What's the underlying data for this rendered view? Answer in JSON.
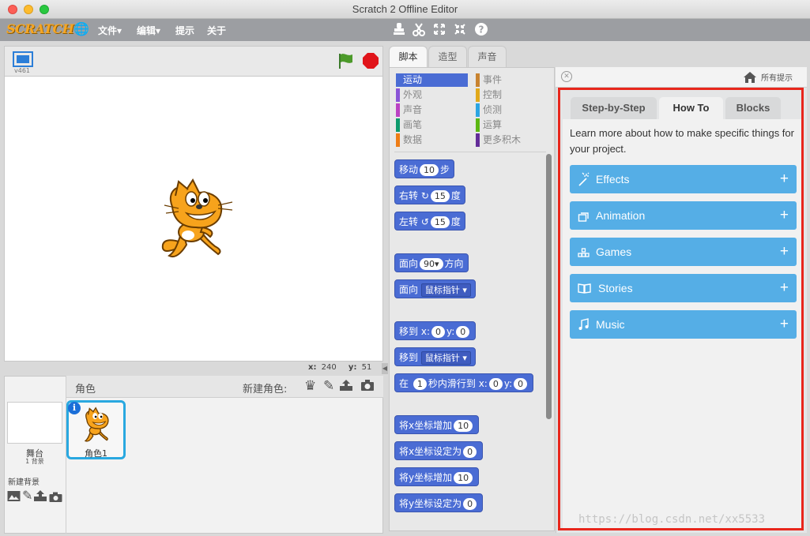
{
  "window": {
    "title": "Scratch 2 Offline Editor"
  },
  "menubar": {
    "logo": "SCRATCH",
    "menus": [
      "文件▾",
      "编辑▾",
      "提示",
      "关于"
    ]
  },
  "stage": {
    "version": "v461",
    "coords": {
      "x_label": "x:",
      "x_value": "240",
      "y_label": "y:",
      "y_value": "51"
    }
  },
  "sprite_panel": {
    "title": "角色",
    "new_sprite_label": "新建角色:",
    "stage_label": "舞台",
    "stage_sub": "1 背景",
    "new_backdrop_label": "新建背景",
    "sprite_name": "角色1"
  },
  "tabs": [
    "脚本",
    "造型",
    "声音"
  ],
  "categories_left": [
    {
      "label": "运动",
      "color": "#4a6cd4"
    },
    {
      "label": "外观",
      "color": "#8a55d7"
    },
    {
      "label": "声音",
      "color": "#bb42c3"
    },
    {
      "label": "画笔",
      "color": "#0e9a6c"
    },
    {
      "label": "数据",
      "color": "#ee7d16"
    }
  ],
  "categories_right": [
    {
      "label": "事件",
      "color": "#c88330"
    },
    {
      "label": "控制",
      "color": "#e1a91a"
    },
    {
      "label": "侦测",
      "color": "#2ca5e2"
    },
    {
      "label": "运算",
      "color": "#5cb712"
    },
    {
      "label": "更多积木",
      "color": "#632d99"
    }
  ],
  "blocks": {
    "move": {
      "pre": "移动",
      "val": "10",
      "post": "步"
    },
    "turn_right": {
      "pre": "右转",
      "val": "15",
      "post": "度"
    },
    "turn_left": {
      "pre": "左转",
      "val": "15",
      "post": "度"
    },
    "point_dir": {
      "pre": "面向",
      "val": "90▾",
      "post": "方向"
    },
    "point_towards": {
      "pre": "面向",
      "dd": "鼠标指针"
    },
    "goto_xy": {
      "pre": "移到",
      "x": "x:",
      "xv": "0",
      "y": "y:",
      "yv": "0"
    },
    "goto": {
      "pre": "移到",
      "dd": "鼠标指针"
    },
    "glide": {
      "pre": "在",
      "secs": "1",
      "mid": "秒内滑行到",
      "x": "x:",
      "xv": "0",
      "y": "y:",
      "yv": "0"
    },
    "change_x": {
      "label": "将x坐标增加",
      "val": "10"
    },
    "set_x": {
      "label": "将x坐标设定为",
      "val": "0"
    },
    "change_y": {
      "label": "将y坐标增加",
      "val": "10"
    },
    "set_y": {
      "label": "将y坐标设定为",
      "val": "0"
    }
  },
  "tips": {
    "home_label": "所有提示",
    "tabs": [
      "Step-by-Step",
      "How To",
      "Blocks"
    ],
    "active_tab": "How To",
    "intro": "Learn more about how to make specific things for your project.",
    "sections": [
      {
        "label": "Effects",
        "icon": "effects-icon"
      },
      {
        "label": "Animation",
        "icon": "animation-icon"
      },
      {
        "label": "Games",
        "icon": "games-icon"
      },
      {
        "label": "Stories",
        "icon": "stories-icon"
      },
      {
        "label": "Music",
        "icon": "music-icon"
      }
    ],
    "watermark": "https://blog.csdn.net/xx5533"
  },
  "colors": {
    "motion": "#4a6cd4",
    "tip_button": "#55aee6",
    "highlight": "#e8261c"
  }
}
